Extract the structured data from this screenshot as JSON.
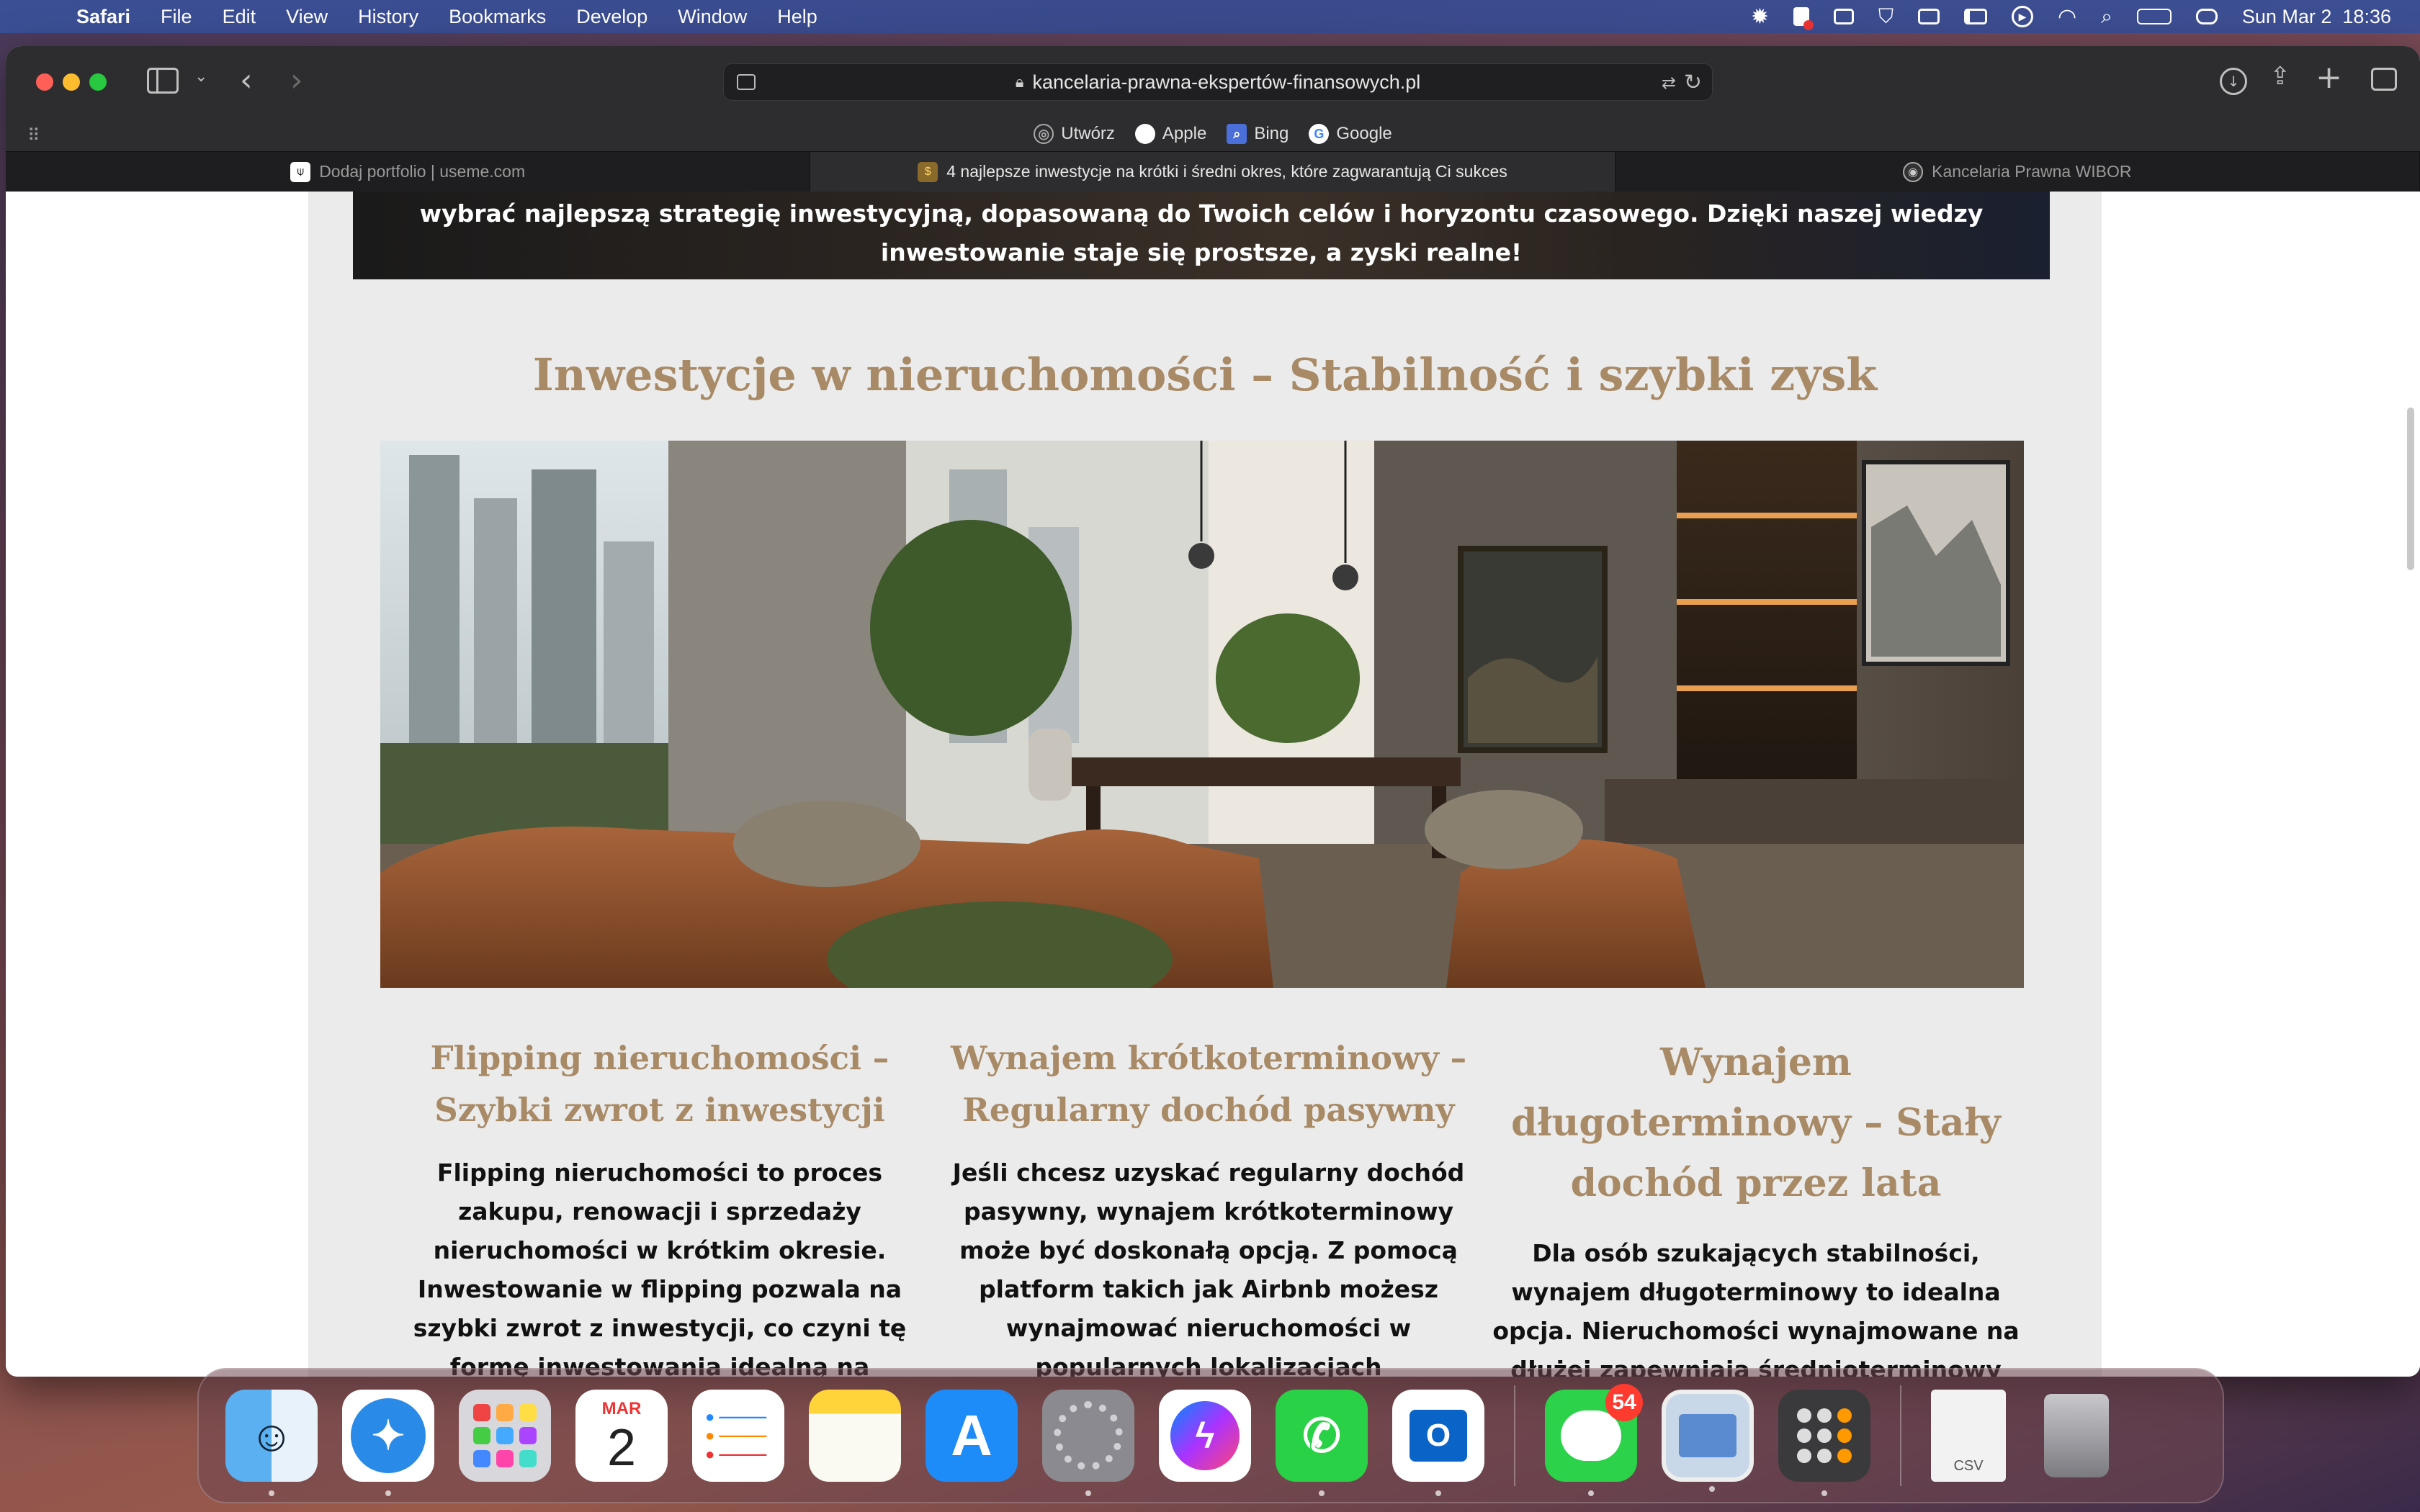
{
  "menubar": {
    "app": "Safari",
    "items": [
      "File",
      "Edit",
      "View",
      "History",
      "Bookmarks",
      "Develop",
      "Window",
      "Help"
    ],
    "clock": "Sun Mar 2  18:36"
  },
  "browser": {
    "url": "kancelaria-prawna-ekspertów-finansowych.pl",
    "favorites": [
      {
        "label": "Utwórz",
        "icon": "globe-icon"
      },
      {
        "label": "Apple",
        "icon": "apple-icon"
      },
      {
        "label": "Bing",
        "icon": "bing-icon"
      },
      {
        "label": "Google",
        "icon": "google-icon"
      }
    ],
    "tabs": [
      {
        "label": "Dodaj portfolio | useme.com",
        "active": false
      },
      {
        "label": "4 najlepsze inwestycje na krótki i średni okres, które zagwarantują Ci sukces",
        "active": true
      },
      {
        "label": "Kancelaria Prawna WIBOR",
        "active": false
      }
    ]
  },
  "page": {
    "banner_text": "wybrać najlepszą strategię inwestycyjną, dopasowaną do Twoich celów i horyzontu czasowego. Dzięki naszej wiedzy inwestowanie staje się prostsze, a zyski realne!",
    "section_title": "Inwestycje w nieruchomości – Stabilność i szybki zysk",
    "columns": [
      {
        "title": "Flipping nieruchomości – Szybki zwrot z inwestycji",
        "body": "Flipping nieruchomości to proces zakupu, renowacji i sprzedaży nieruchomości w krótkim okresie. Inwestowanie w flipping pozwala na szybki zwrot z inwestycji, co czyni tę formę inwestowania idealną na krótkoterminowe inwestycje. Dzięki naszym doświadczeniom pomożemy Ci"
      },
      {
        "title": "Wynajem krótkoterminowy – Regularny dochód pasywny",
        "body": "Jeśli chcesz uzyskać regularny dochód pasywny, wynajem krótkoterminowy może być doskonałą opcją. Z pomocą platform takich jak Airbnb możesz wynajmować nieruchomości w popularnych lokalizacjach turystycznych, zapewniając sobie wysokie dochody w krótkim okresie. Nasz zespół"
      },
      {
        "title": "Wynajem długoterminowy – Stały dochód przez lata",
        "body": "Dla osób szukających stabilności, wynajem długoterminowy to idealna opcja. Nieruchomości wynajmowane na dłużej zapewniają średnioterminowy dochód, który utrzymuje się przez długie lata. To"
      }
    ]
  },
  "dock": {
    "calendar_month": "MAR",
    "calendar_day": "2",
    "messages_badge": "54",
    "csv_label": "CSV"
  },
  "colors": {
    "accent_gold": "#a88a66",
    "menubar": "#3a4a8c"
  }
}
